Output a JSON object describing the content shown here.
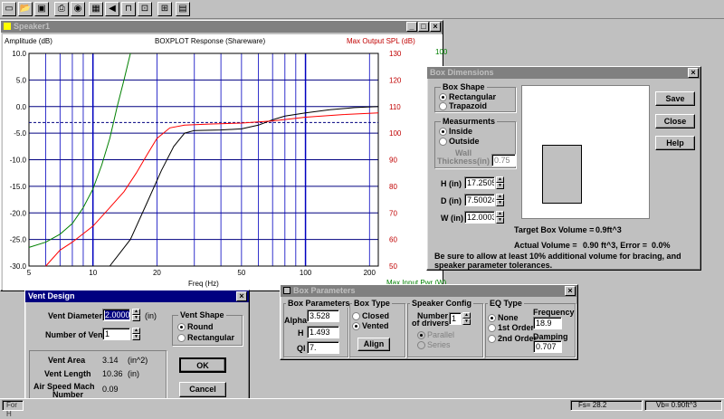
{
  "toolbar": {
    "buttons": [
      {
        "name": "new-icon",
        "glyph": "▭"
      },
      {
        "name": "open-icon",
        "glyph": "📂"
      },
      {
        "name": "save-icon",
        "glyph": "▣"
      },
      {
        "name": "print-icon",
        "glyph": "⎙"
      },
      {
        "name": "find-icon",
        "glyph": "◉"
      },
      {
        "name": "box-icon",
        "glyph": "▦"
      },
      {
        "name": "speaker-icon",
        "glyph": "◀"
      },
      {
        "name": "vent-icon",
        "glyph": "⊓"
      },
      {
        "name": "tool-icon",
        "glyph": "⊡"
      },
      {
        "name": "chart-icon",
        "glyph": "⊞"
      },
      {
        "name": "filter-icon",
        "glyph": "▤"
      }
    ]
  },
  "speaker": {
    "title": "Speaker1",
    "left_axis_label": "Amplitude (dB)",
    "chart_title": "BOXPLOT Response (Shareware)",
    "right_axis_label": "Max Output SPL (dB)",
    "far_right_top": "100",
    "x_axis_label": "Freq (Hz)",
    "bottom_right_label": "Max Input Pwr (W)"
  },
  "chart_data": {
    "type": "line",
    "xlabel": "Freq (Hz)",
    "ylabel": "Amplitude (dB)",
    "x_scale": "log",
    "xlim": [
      5,
      220
    ],
    "ylim": [
      -30,
      10
    ],
    "y_ticks": [
      "10.0",
      "5.0",
      "0.0",
      "-5.0",
      "-10.0",
      "-15.0",
      "-20.0",
      "-25.0",
      "-30.0"
    ],
    "y2_ticks": [
      "130",
      "120",
      "110",
      "100",
      "90",
      "80",
      "70",
      "60",
      "50"
    ],
    "x_ticks": [
      {
        "v": 5,
        "t": "5"
      },
      {
        "v": 10,
        "t": "10"
      },
      {
        "v": 20,
        "t": "20"
      },
      {
        "v": 50,
        "t": "50"
      },
      {
        "v": 100,
        "t": "100"
      },
      {
        "v": 200,
        "t": "200"
      }
    ],
    "reference_line_db": -3,
    "grid": true,
    "series": [
      {
        "color": "#000000",
        "points": [
          [
            12,
            -30
          ],
          [
            15,
            -25
          ],
          [
            18,
            -18
          ],
          [
            21,
            -12
          ],
          [
            24,
            -7.5
          ],
          [
            27,
            -5
          ],
          [
            30,
            -4.5
          ],
          [
            40,
            -4.4
          ],
          [
            50,
            -4.2
          ],
          [
            60,
            -3.5
          ],
          [
            70,
            -2.5
          ],
          [
            80,
            -1.8
          ],
          [
            100,
            -1.2
          ],
          [
            130,
            -0.6
          ],
          [
            170,
            -0.2
          ],
          [
            220,
            0
          ]
        ]
      },
      {
        "color": "#ff0000",
        "points": [
          [
            6,
            -30
          ],
          [
            7,
            -27
          ],
          [
            8,
            -25.5
          ],
          [
            10,
            -22.5
          ],
          [
            12,
            -19
          ],
          [
            14,
            -16
          ],
          [
            16,
            -12.5
          ],
          [
            18,
            -9
          ],
          [
            20,
            -6
          ],
          [
            23,
            -4
          ],
          [
            27,
            -3.5
          ],
          [
            35,
            -3.3
          ],
          [
            50,
            -3.1
          ],
          [
            70,
            -2.7
          ],
          [
            100,
            -2
          ],
          [
            150,
            -1.5
          ],
          [
            220,
            -1.2
          ]
        ]
      },
      {
        "color": "#008000",
        "points": [
          [
            5,
            -26.5
          ],
          [
            6,
            -25.5
          ],
          [
            7,
            -24
          ],
          [
            8,
            -22
          ],
          [
            9,
            -19
          ],
          [
            10,
            -15.5
          ],
          [
            11,
            -11
          ],
          [
            12,
            -6
          ],
          [
            13,
            0
          ],
          [
            14,
            5
          ],
          [
            15,
            10
          ]
        ]
      }
    ]
  },
  "box_dimensions": {
    "title": "Box Dimensions",
    "shape_group": "Box Shape",
    "shape_rect": "Rectangular",
    "shape_trap": "Trapazoid",
    "meas_group": "Measurments",
    "meas_inside": "Inside",
    "meas_outside": "Outside",
    "wall_label_1": "Wall",
    "wall_label_2": "Thickness(in)",
    "wall_value": "0.75",
    "h_label": "H (in)",
    "h_value": "17.2505",
    "d_label": "D (in)",
    "d_value": "7.50024",
    "w_label": "W (in)",
    "w_value": "12.0003",
    "save": "Save",
    "close": "Close",
    "help": "Help",
    "target_label": "Target Box Volume =",
    "target_value": "0.9ft^3",
    "actual_label": "Actual Volume =",
    "actual_value": "0.90 ft^3, Error =",
    "error_value": "0.0%",
    "note": "Be sure to allow at least 10% additional volume for bracing, and speaker parameter tolerances."
  },
  "vent": {
    "title": "Vent Design",
    "diameter_label": "Vent Diameter",
    "diameter_value": "2.0000",
    "diameter_unit": "(in)",
    "count_label": "Number of Vents",
    "count_value": "1",
    "shape_group": "Vent Shape",
    "shape_round": "Round",
    "shape_rect": "Rectangular",
    "area_label": "Vent Area",
    "area_value": "3.14",
    "area_unit": "(in^2)",
    "length_label": "Vent Length",
    "length_value": "10.36",
    "length_unit": "(in)",
    "mach_label_1": "Air Speed Mach",
    "mach_label_2": "Number",
    "mach_value": "0.09",
    "ok": "OK",
    "cancel": "Cancel"
  },
  "box_params": {
    "title": "Box Parameters",
    "params_group": "Box Parameters",
    "alpha_label": "Alpha",
    "alpha_value": "3.528",
    "h_label": "H",
    "h_value": "1.493",
    "ql_label": "Ql",
    "ql_value": "7.",
    "type_group": "Box Type",
    "type_closed": "Closed",
    "type_vented": "Vented",
    "align": "Align",
    "config_group": "Speaker Config",
    "drivers_label_1": "Number",
    "drivers_label_2": "of drivers",
    "drivers_value": "1",
    "parallel": "Parallel",
    "series": "Series",
    "eq_group": "EQ Type",
    "eq_none": "None",
    "eq_first": "1st Order",
    "eq_second": "2nd Order",
    "freq_label": "Frequency",
    "freq_value": "18.9",
    "damp_label": "Damping",
    "damp_value": "0.707"
  },
  "status": {
    "left": "For H",
    "fs": "Fs= 28.2",
    "vb": "Vb= 0.90ft^3"
  }
}
